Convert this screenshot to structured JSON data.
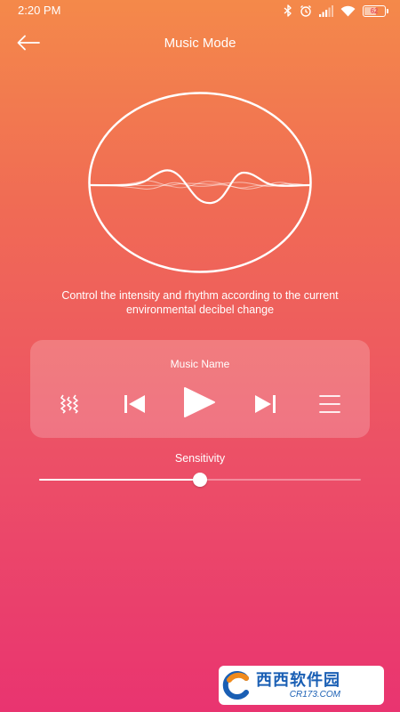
{
  "status_bar": {
    "time": "2:20 PM",
    "battery": "62",
    "icons": [
      "bluetooth-icon",
      "alarm-icon",
      "signal-icon",
      "wifi-icon",
      "battery-icon"
    ]
  },
  "header": {
    "title": "Music Mode",
    "back_icon": "arrow-left-icon"
  },
  "visualizer": {
    "description": "Control the intensity and rhythm according to the current environmental decibel change"
  },
  "player": {
    "track_name": "Music Name",
    "controls": [
      "equalizer-icon",
      "previous-icon",
      "play-icon",
      "next-icon",
      "playlist-icon"
    ]
  },
  "sensitivity": {
    "label": "Sensitivity",
    "value": 0.5
  },
  "watermark": {
    "brand": "西西软件园",
    "domain": "CR173.COM"
  },
  "colors": {
    "gradient_top": "#F4894A",
    "gradient_bottom": "#E93470",
    "foreground": "#FFFFFF"
  }
}
